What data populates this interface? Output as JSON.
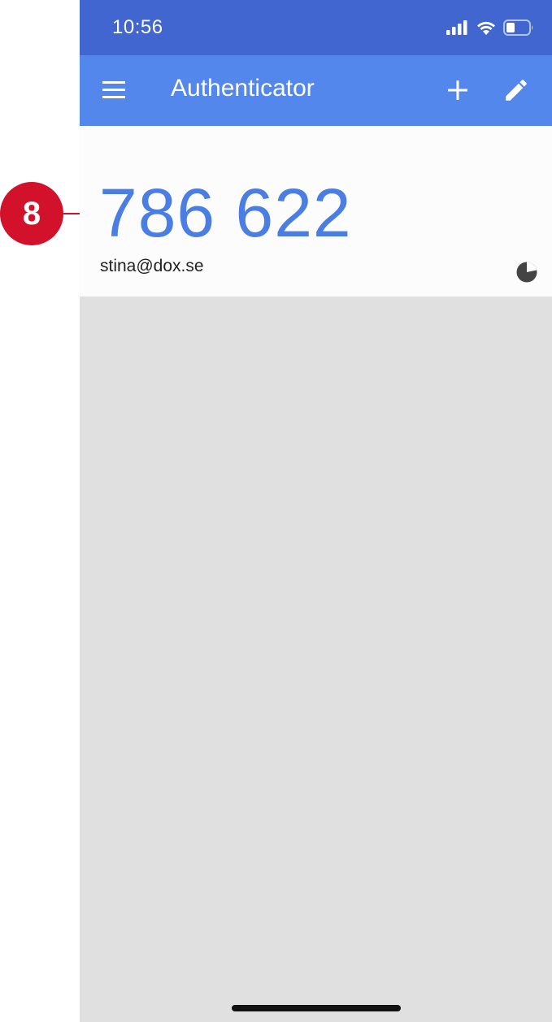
{
  "status_bar": {
    "time": "10:56",
    "icons": [
      "signal-icon",
      "wifi-icon",
      "battery-icon"
    ]
  },
  "app_bar": {
    "title": "Authenticator",
    "icons": [
      "menu-icon",
      "add-icon",
      "edit-icon"
    ]
  },
  "account": {
    "code": "786 622",
    "email": "stina@dox.se",
    "timer_icon": "timer-pie-icon"
  },
  "callout": {
    "number": "8"
  },
  "colors": {
    "status_bar": "#4166d0",
    "app_bar": "#5387ec",
    "code": "#4a7ee3",
    "callout": "#d2112b",
    "background": "#e0e0e0"
  }
}
